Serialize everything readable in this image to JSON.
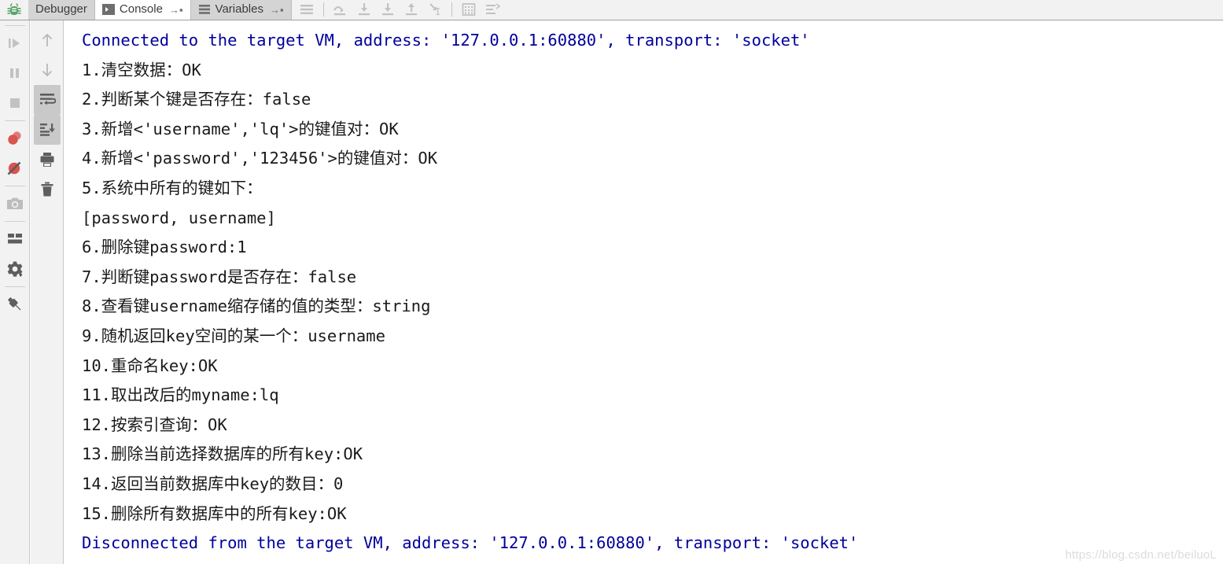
{
  "window": {
    "app_icon": "bug-icon"
  },
  "tabs": [
    {
      "label": "Debugger",
      "icon": "",
      "selected": false,
      "pin": ""
    },
    {
      "label": "Console",
      "icon": "console-icon",
      "selected": true,
      "pin": "→▪"
    },
    {
      "label": "Variables",
      "icon": "variables-icon",
      "selected": false,
      "pin": "→▪"
    }
  ],
  "toolbar": {
    "buttons": [
      {
        "name": "menu-button",
        "icon": "hamburger-icon"
      },
      {
        "name": "step-over-button",
        "icon": "step-over-icon"
      },
      {
        "name": "step-into-button",
        "icon": "step-into-icon"
      },
      {
        "name": "force-step-into-button",
        "icon": "force-step-into-icon"
      },
      {
        "name": "step-out-button",
        "icon": "step-out-icon"
      },
      {
        "name": "run-to-cursor-button",
        "icon": "run-to-cursor-icon"
      },
      {
        "name": "evaluate-expression-button",
        "icon": "calculator-icon"
      },
      {
        "name": "sort-values-button",
        "icon": "sort-icon"
      }
    ]
  },
  "left_rail": {
    "buttons": [
      {
        "name": "resume-program-button",
        "icon": "resume-icon"
      },
      {
        "name": "pause-program-button",
        "icon": "pause-icon"
      },
      {
        "name": "stop-button",
        "icon": "stop-icon"
      },
      {
        "name": "view-breakpoints-button",
        "icon": "breakpoints-icon"
      },
      {
        "name": "mute-breakpoints-button",
        "icon": "mute-breakpoints-icon"
      },
      {
        "name": "get-thread-dump-button",
        "icon": "camera-icon"
      },
      {
        "name": "restore-layout-button",
        "icon": "layout-icon"
      },
      {
        "name": "settings-button",
        "icon": "gear-icon"
      },
      {
        "name": "pin-tab-button",
        "icon": "pin-icon"
      }
    ]
  },
  "console_rail": {
    "buttons": [
      {
        "name": "up-the-stack-trace-button",
        "icon": "arrow-up-icon",
        "active": false
      },
      {
        "name": "down-the-stack-trace-button",
        "icon": "arrow-down-icon",
        "active": false
      },
      {
        "name": "soft-wrap-button",
        "icon": "soft-wrap-icon",
        "active": true
      },
      {
        "name": "scroll-to-end-button",
        "icon": "scroll-to-end-icon",
        "active": true
      },
      {
        "name": "print-button",
        "icon": "printer-icon",
        "active": false
      },
      {
        "name": "clear-all-button",
        "icon": "trash-icon",
        "active": false
      }
    ]
  },
  "console": {
    "lines": [
      {
        "text": "Connected to the target VM, address: '127.0.0.1:60880', transport: 'socket'",
        "type": "sys"
      },
      {
        "text": "1.清空数据：OK",
        "type": "out"
      },
      {
        "text": "2.判断某个键是否存在：false",
        "type": "out"
      },
      {
        "text": "3.新增<'username','lq'>的键值对：OK",
        "type": "out"
      },
      {
        "text": "4.新增<'password','123456'>的键值对：OK",
        "type": "out"
      },
      {
        "text": "5.系统中所有的键如下：",
        "type": "out"
      },
      {
        "text": "[password, username]",
        "type": "out"
      },
      {
        "text": "6.删除键password:1",
        "type": "out"
      },
      {
        "text": "7.判断键password是否存在：false",
        "type": "out"
      },
      {
        "text": "8.查看键username缩存储的值的类型：string",
        "type": "out"
      },
      {
        "text": "9.随机返回key空间的某一个：username",
        "type": "out"
      },
      {
        "text": "10.重命名key:OK",
        "type": "out"
      },
      {
        "text": "11.取出改后的myname:lq",
        "type": "out"
      },
      {
        "text": "12.按索引查询：OK",
        "type": "out"
      },
      {
        "text": "13.删除当前选择数据库的所有key:OK",
        "type": "out"
      },
      {
        "text": "14.返回当前数据库中key的数目：0",
        "type": "out"
      },
      {
        "text": "15.删除所有数据库中的所有key:OK",
        "type": "out"
      },
      {
        "text": "Disconnected from the target VM, address: '127.0.0.1:60880', transport: 'socket'",
        "type": "sys"
      }
    ]
  },
  "watermark": {
    "text": "https://blog.csdn.net/beiluoL"
  },
  "colors": {
    "system_message": "#00009b",
    "output_text": "#1a1a1a",
    "tab_selected_bg": "#ffffff",
    "tab_bg": "#d4d4d4",
    "toolbar_bg": "#f2f2f2",
    "breakpoint_red": "#db5c5c"
  }
}
